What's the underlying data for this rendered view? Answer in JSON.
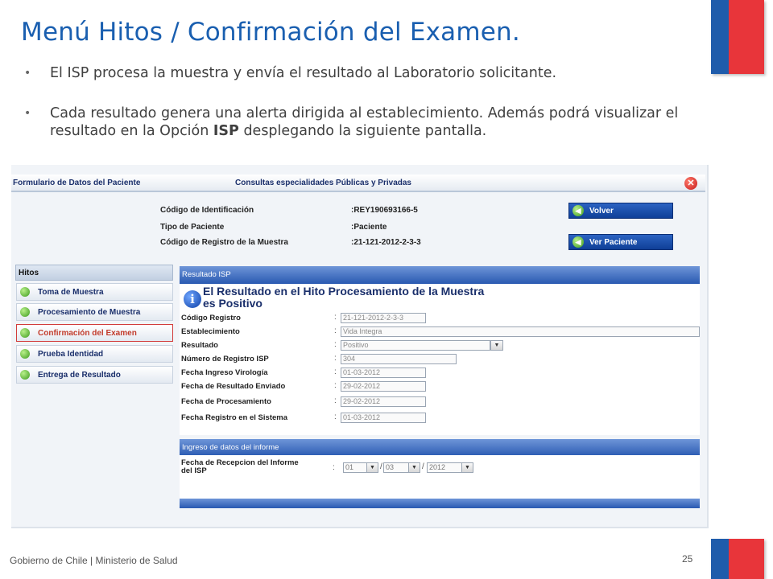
{
  "slide": {
    "title": "Menú Hitos / Confirmación del Examen.",
    "bullets": {
      "b1": "El ISP procesa la muestra y envía el resultado al Laboratorio solicitante.",
      "b2_pre": "Cada resultado genera una alerta dirigida al establecimiento. Además podrá visualizar el resultado en la Opción ",
      "b2_bold": "ISP",
      "b2_post": " desplegando la siguiente pantalla."
    },
    "footer": "Gobierno de Chile | Ministerio de Salud",
    "page_number": "25",
    "colors": {
      "title": "#1a5fb0",
      "flag_blue": "#1f5cab",
      "flag_red": "#e8353a"
    }
  },
  "app": {
    "topbar": {
      "left": "Formulario de Datos del Paciente",
      "center": "Consultas especialidades Públicas y Privadas"
    },
    "info": {
      "id_label": "Código de Identificación",
      "id_value": ":REY190693166-5",
      "tipo_label": "Tipo de Paciente",
      "tipo_value": ":Paciente",
      "registro_label": "Código de Registro de la Muestra",
      "registro_value": ":21-121-2012-2-3-3"
    },
    "buttons": {
      "volver": "Volver",
      "ver_paciente": "Ver Paciente"
    },
    "hitos": {
      "header": "Hitos",
      "items": [
        {
          "label": "Toma de Muestra"
        },
        {
          "label": "Procesamiento de Muestra"
        },
        {
          "label": "Confirmación del Examen",
          "active": true
        },
        {
          "label": "Prueba Identidad"
        },
        {
          "label": "Entrega de Resultado"
        }
      ]
    },
    "resultado": {
      "section_title": "Resultado ISP",
      "heading_line1": "El Resultado en el Hito Procesamiento de la Muestra",
      "heading_line2": "es Positivo",
      "fields": {
        "codigo_registro": {
          "label": "Código Registro",
          "value": "21-121-2012-2-3-3"
        },
        "establecimiento": {
          "label": "Establecimiento",
          "value": "Vida Integra"
        },
        "resultado": {
          "label": "Resultado",
          "value": "Positivo"
        },
        "numero_registro_isp": {
          "label": "Número de Registro ISP",
          "value": "304"
        },
        "fecha_ingreso_virologia": {
          "label": "Fecha Ingreso Virología",
          "value": "01-03-2012"
        },
        "fecha_resultado_enviado": {
          "label": "Fecha de Resultado Enviado",
          "value": "29-02-2012"
        },
        "fecha_procesamiento": {
          "label": "Fecha de Procesamiento",
          "value": "29-02-2012"
        },
        "fecha_registro_sistema": {
          "label": "Fecha Registro en el Sistema",
          "value": "01-03-2012"
        }
      }
    },
    "informe": {
      "section_title": "Ingreso de datos del informe",
      "label_line1": "Fecha de Recepcion del Informe",
      "label_line2": "del ISP",
      "day": "01",
      "month": "03",
      "year": "2012"
    }
  }
}
